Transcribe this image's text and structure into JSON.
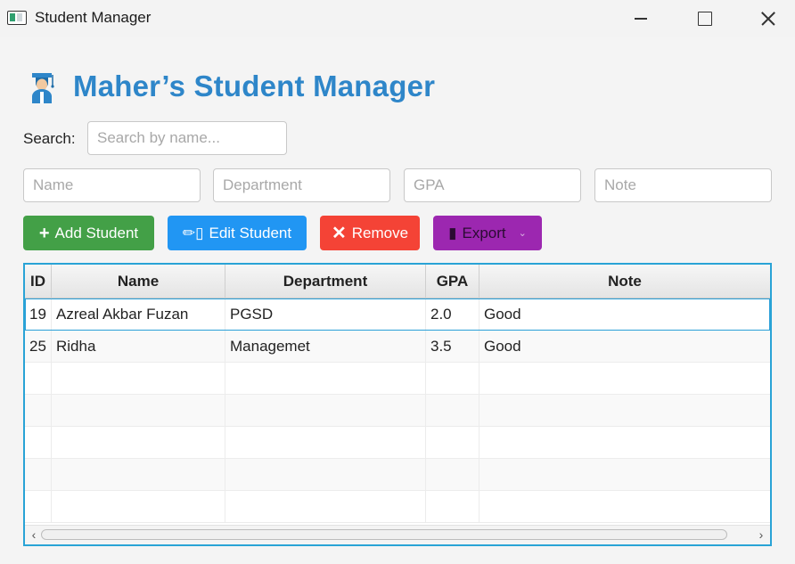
{
  "window": {
    "title": "Student Manager"
  },
  "header": {
    "title": "Maher’s Student Manager",
    "icon": "student-graduate-icon"
  },
  "search": {
    "label": "Search:",
    "placeholder": "Search by name..."
  },
  "form": {
    "name_placeholder": "Name",
    "department_placeholder": "Department",
    "gpa_placeholder": "GPA",
    "note_placeholder": "Note"
  },
  "buttons": {
    "add": {
      "icon": "+",
      "label": "Add Student"
    },
    "edit": {
      "icon": "✏▯",
      "label": "Edit Student"
    },
    "remove": {
      "icon": "✕",
      "label": "Remove"
    },
    "export": {
      "icon": "▮",
      "label": "Export",
      "chevron": "⌄"
    }
  },
  "colors": {
    "accent": "#2e86c9",
    "add": "#43a047",
    "edit": "#2196f3",
    "remove": "#f44336",
    "export": "#9c27b0",
    "table_border": "#29a3d6"
  },
  "table": {
    "columns": [
      "ID",
      "Name",
      "Department",
      "GPA",
      "Note"
    ],
    "rows": [
      [
        "19",
        "Azreal Akbar Fuzan",
        "PGSD",
        "2.0",
        "Good"
      ],
      [
        "25",
        "Ridha",
        "Managemet",
        "3.5",
        "Good"
      ]
    ],
    "selected_row": 0
  },
  "scrollbar": {
    "left_arrow": "‹",
    "right_arrow": "›"
  }
}
